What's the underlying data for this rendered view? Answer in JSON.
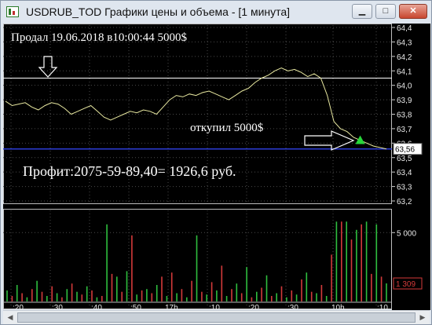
{
  "window": {
    "title": "USDRUB_TOD Графики цены и объема - [1 минута]",
    "minimize_glyph": "▁",
    "maximize_glyph": "□",
    "close_glyph": "✕"
  },
  "annotations": {
    "sold_text": "Продал 19.06.2018 в10:00:44 5000$",
    "bought_back_text": "откупил 5000$",
    "profit_text": "Профит:2075-59-89,40=  1926,6 руб."
  },
  "price_axis": {
    "ticks": [
      "64,4",
      "64,3",
      "64,2",
      "64,1",
      "64,0",
      "63,9",
      "63,8",
      "63,7",
      "63,6",
      "63,5",
      "63,4",
      "63,3",
      "63,2"
    ],
    "last_price_label": "63,56"
  },
  "volume_axis": {
    "ticks": [
      "5 000"
    ],
    "last_volume_label": "1 309"
  },
  "time_axis": {
    "labels": [
      ":20",
      ":30",
      ":40",
      ":50",
      "17h",
      ":10",
      ":20",
      ":30",
      "10h",
      ":10"
    ],
    "date_label": "20"
  },
  "colors": {
    "price_line": "#e8e8a0",
    "level_line": "#ffffff",
    "current_line": "#2c3cd6",
    "volume_red": "#d43a3a",
    "volume_green": "#2fbf3f",
    "background": "#000000",
    "grid": "#4a4a4a"
  },
  "chart_data": [
    {
      "type": "line",
      "title": "",
      "ylim": [
        63.2,
        64.4
      ],
      "series": [
        {
          "name": "",
          "values": [
            63.89,
            63.86,
            63.87,
            63.88,
            63.85,
            63.83,
            63.86,
            63.88,
            63.87,
            63.84,
            63.8,
            63.82,
            63.84,
            63.86,
            63.82,
            63.78,
            63.76,
            63.78,
            63.8,
            63.82,
            63.81,
            63.83,
            63.82,
            63.8,
            63.85,
            63.9,
            63.93,
            63.92,
            63.94,
            63.93,
            63.95,
            63.96,
            63.94,
            63.92,
            63.9,
            63.93,
            63.96,
            63.98,
            64.02,
            64.05,
            64.07,
            64.1,
            64.12,
            64.1,
            64.11,
            64.09,
            64.06,
            64.08,
            64.05,
            63.93,
            63.75,
            63.7,
            63.68,
            63.64,
            63.62,
            63.6,
            63.58,
            63.57,
            63.56
          ]
        }
      ],
      "reference_levels": [
        64.05,
        63.56
      ]
    },
    {
      "type": "bar",
      "title": "",
      "ylim": [
        0,
        6500
      ],
      "series": [
        {
          "name": "",
          "values": [
            800,
            -400,
            1200,
            -600,
            300,
            -900,
            1500,
            -700,
            400,
            -1100,
            600,
            -300,
            900,
            -1300,
            700,
            -500,
            1100,
            -800,
            300,
            -400,
            5600,
            -2000,
            1800,
            -700,
            2200,
            -4800,
            500,
            -800,
            900,
            -600,
            1200,
            -1800,
            400,
            -2100,
            600,
            -900,
            300,
            -1500,
            4800,
            -700,
            500,
            -1400,
            800,
            -2600,
            400,
            -900,
            1300,
            -600,
            2500,
            -300,
            700,
            -1000,
            1900,
            -400,
            600,
            -1100,
            300,
            -800,
            500,
            -1600,
            2100,
            -700,
            600,
            -1200,
            400,
            -3400,
            5800,
            -5800,
            5800,
            -4500,
            5200,
            -5600,
            5800,
            -2000,
            5600,
            -1800,
            1309
          ]
        }
      ]
    }
  ]
}
